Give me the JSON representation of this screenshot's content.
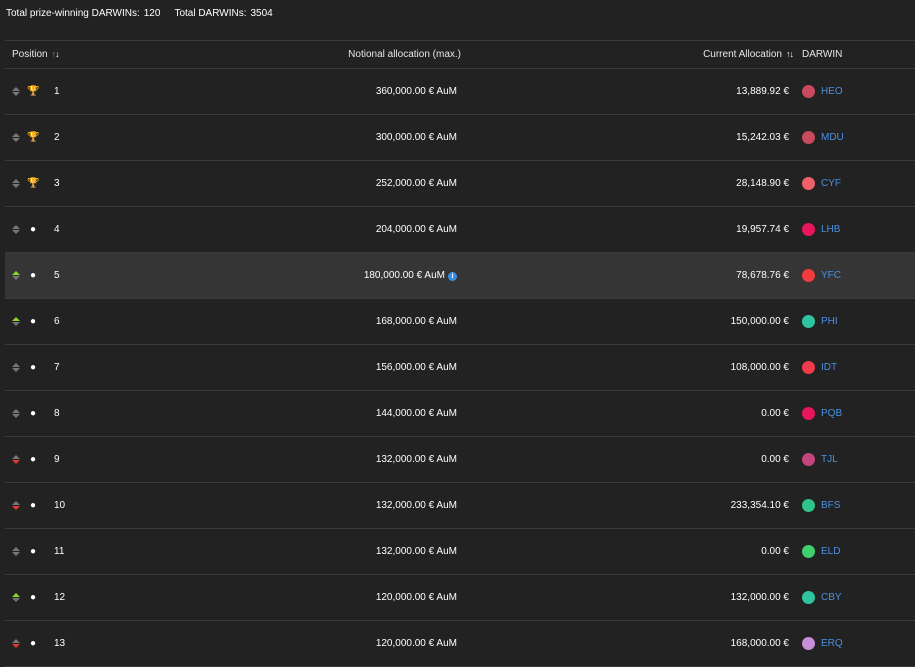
{
  "summary": {
    "prize_label": "Total prize-winning DARWINs:",
    "prize_count": "120",
    "total_label": "Total DARWINs:",
    "total_count": "3504"
  },
  "headers": {
    "position": "Position",
    "notional": "Notional allocation (max.)",
    "current": "Current Allocation",
    "darwin": "DARWIN"
  },
  "rows": [
    {
      "pos": "1",
      "trend": "neutral",
      "award": "gold-trophy-icon",
      "award_class": "gold",
      "award_glyph": "🏆",
      "notional": "360,000.00 € AuM",
      "current": "13,889.92 €",
      "darwin": "HEO",
      "color": "#c94a5e",
      "info": false,
      "highlight": false
    },
    {
      "pos": "2",
      "trend": "neutral",
      "award": "silver-trophy-icon",
      "award_class": "silver",
      "award_glyph": "🏆",
      "notional": "300,000.00 € AuM",
      "current": "15,242.03 €",
      "darwin": "MDU",
      "color": "#c94a5e",
      "info": false,
      "highlight": false
    },
    {
      "pos": "3",
      "trend": "neutral",
      "award": "bronze-trophy-icon",
      "award_class": "bronze",
      "award_glyph": "🏆",
      "notional": "252,000.00 € AuM",
      "current": "28,148.90 €",
      "darwin": "CYF",
      "color": "#f0606a",
      "info": false,
      "highlight": false
    },
    {
      "pos": "4",
      "trend": "neutral",
      "award": "medal-icon",
      "award_class": "medal",
      "award_glyph": "●",
      "notional": "204,000.00 € AuM",
      "current": "19,957.74 €",
      "darwin": "LHB",
      "color": "#e8175d",
      "info": false,
      "highlight": false
    },
    {
      "pos": "5",
      "trend": "up",
      "award": "medal-icon",
      "award_class": "medal",
      "award_glyph": "●",
      "notional": "180,000.00 € AuM",
      "current": "78,678.76 €",
      "darwin": "YFC",
      "color": "#f03c3c",
      "info": true,
      "highlight": true
    },
    {
      "pos": "6",
      "trend": "up",
      "award": "medal-icon",
      "award_class": "medal",
      "award_glyph": "●",
      "notional": "168,000.00 € AuM",
      "current": "150,000.00 €",
      "darwin": "PHI",
      "color": "#2ec4a0",
      "info": false,
      "highlight": false
    },
    {
      "pos": "7",
      "trend": "neutral",
      "award": "medal-icon",
      "award_class": "medal",
      "award_glyph": "●",
      "notional": "156,000.00 € AuM",
      "current": "108,000.00 €",
      "darwin": "IDT",
      "color": "#f03c4a",
      "info": false,
      "highlight": false
    },
    {
      "pos": "8",
      "trend": "neutral",
      "award": "medal-icon",
      "award_class": "medal",
      "award_glyph": "●",
      "notional": "144,000.00 € AuM",
      "current": "0.00 €",
      "darwin": "PQB",
      "color": "#e8175d",
      "info": false,
      "highlight": false
    },
    {
      "pos": "9",
      "trend": "down",
      "award": "medal-icon",
      "award_class": "medal",
      "award_glyph": "●",
      "notional": "132,000.00 € AuM",
      "current": "0.00 €",
      "darwin": "TJL",
      "color": "#c2457e",
      "info": false,
      "highlight": false
    },
    {
      "pos": "10",
      "trend": "down",
      "award": "medal-icon",
      "award_class": "medal",
      "award_glyph": "●",
      "notional": "132,000.00 € AuM",
      "current": "233,354.10 €",
      "darwin": "BFS",
      "color": "#2ec48a",
      "info": false,
      "highlight": false
    },
    {
      "pos": "11",
      "trend": "neutral",
      "award": "medal-icon",
      "award_class": "medal",
      "award_glyph": "●",
      "notional": "132,000.00 € AuM",
      "current": "0.00 €",
      "darwin": "ELD",
      "color": "#3ecf6e",
      "info": false,
      "highlight": false
    },
    {
      "pos": "12",
      "trend": "up",
      "award": "medal-icon",
      "award_class": "medal",
      "award_glyph": "●",
      "notional": "120,000.00 € AuM",
      "current": "132,000.00 €",
      "darwin": "CBY",
      "color": "#2ec4a0",
      "info": false,
      "highlight": false
    },
    {
      "pos": "13",
      "trend": "down",
      "award": "medal-icon",
      "award_class": "medal",
      "award_glyph": "●",
      "notional": "120,000.00 € AuM",
      "current": "168,000.00 €",
      "darwin": "ERQ",
      "color": "#c98ed8",
      "info": false,
      "highlight": false
    }
  ]
}
